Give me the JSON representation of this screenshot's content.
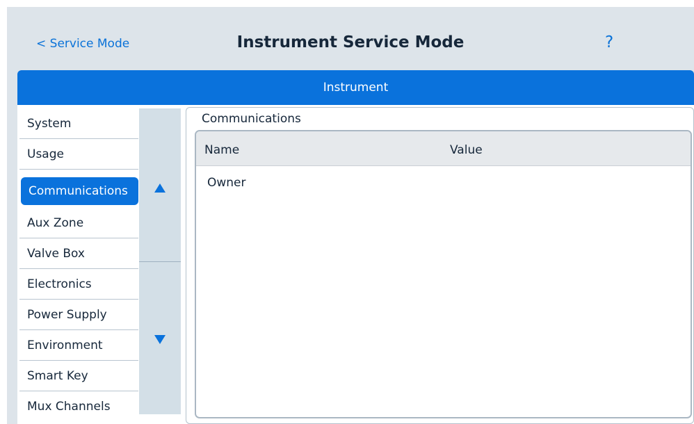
{
  "header": {
    "back_label": "< Service Mode",
    "title": "Instrument Service Mode",
    "help_label": "?"
  },
  "band": {
    "title": "Instrument"
  },
  "nav": {
    "items": [
      {
        "label": "System",
        "selected": false
      },
      {
        "label": "Usage",
        "selected": false
      },
      {
        "label": "Communications",
        "selected": true
      },
      {
        "label": "Aux Zone",
        "selected": false
      },
      {
        "label": "Valve Box",
        "selected": false
      },
      {
        "label": "Electronics",
        "selected": false
      },
      {
        "label": "Power Supply",
        "selected": false
      },
      {
        "label": "Environment",
        "selected": false
      },
      {
        "label": "Smart Key",
        "selected": false
      },
      {
        "label": "Mux Channels",
        "selected": false
      }
    ],
    "scroll_up_icon": "triangle-up-icon",
    "scroll_down_icon": "triangle-down-icon"
  },
  "panel": {
    "title": "Communications",
    "columns": [
      "Name",
      "Value"
    ],
    "rows": [
      {
        "name": "Owner",
        "value": ""
      }
    ]
  },
  "colors": {
    "accent": "#0a72dc",
    "background": "#dde4ea"
  }
}
